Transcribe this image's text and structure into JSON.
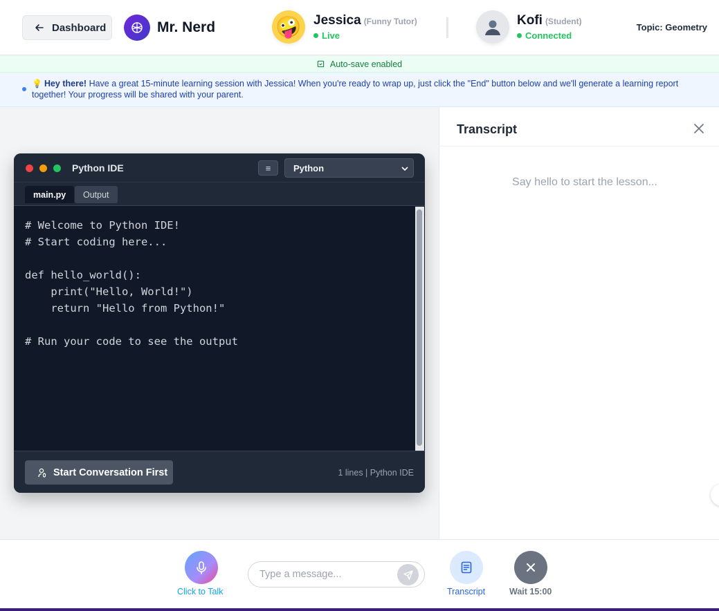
{
  "header": {
    "dashboard_label": "Dashboard",
    "brand_name": "Mr. Nerd",
    "tutor": {
      "name": "Jessica",
      "role": "(Funny Tutor)",
      "status": "Live",
      "avatar_emoji": "🤪"
    },
    "student": {
      "name": "Kofi",
      "role": "(Student)",
      "status": "Connected"
    },
    "topic": "Topic: Geometry"
  },
  "autosave": "Auto-save enabled",
  "notice": {
    "bulb": "💡",
    "greeting": "Hey there!",
    "message": " Have a great 15-minute learning session with Jessica! When you're ready to wrap up, just click the \"End\" button below and we'll generate a learning report together! Your progress will be shared with your parent."
  },
  "ide": {
    "title": "Python IDE",
    "menu_icon": "≡",
    "language": "Python",
    "tabs": [
      "main.py",
      "Output"
    ],
    "code": "# Welcome to Python IDE!\n# Start coding here...\n\ndef hello_world():\n    print(\"Hello, World!\")\n    return \"Hello from Python!\"\n\n# Run your code to see the output",
    "start_button": "Start Conversation First",
    "status": "1 lines | Python IDE"
  },
  "transcript": {
    "title": "Transcript",
    "empty_text": "Say hello to start the lesson..."
  },
  "bottom": {
    "mic_label": "Click to Talk",
    "input_placeholder": "Type a message...",
    "transcript_label": "Transcript",
    "wait_label": "Wait 15:00"
  },
  "colors": {
    "live_green": "#22c55e",
    "ide_bg": "#111827",
    "accent_blue": "#2563eb",
    "brand_purple": "#6d28d9"
  }
}
